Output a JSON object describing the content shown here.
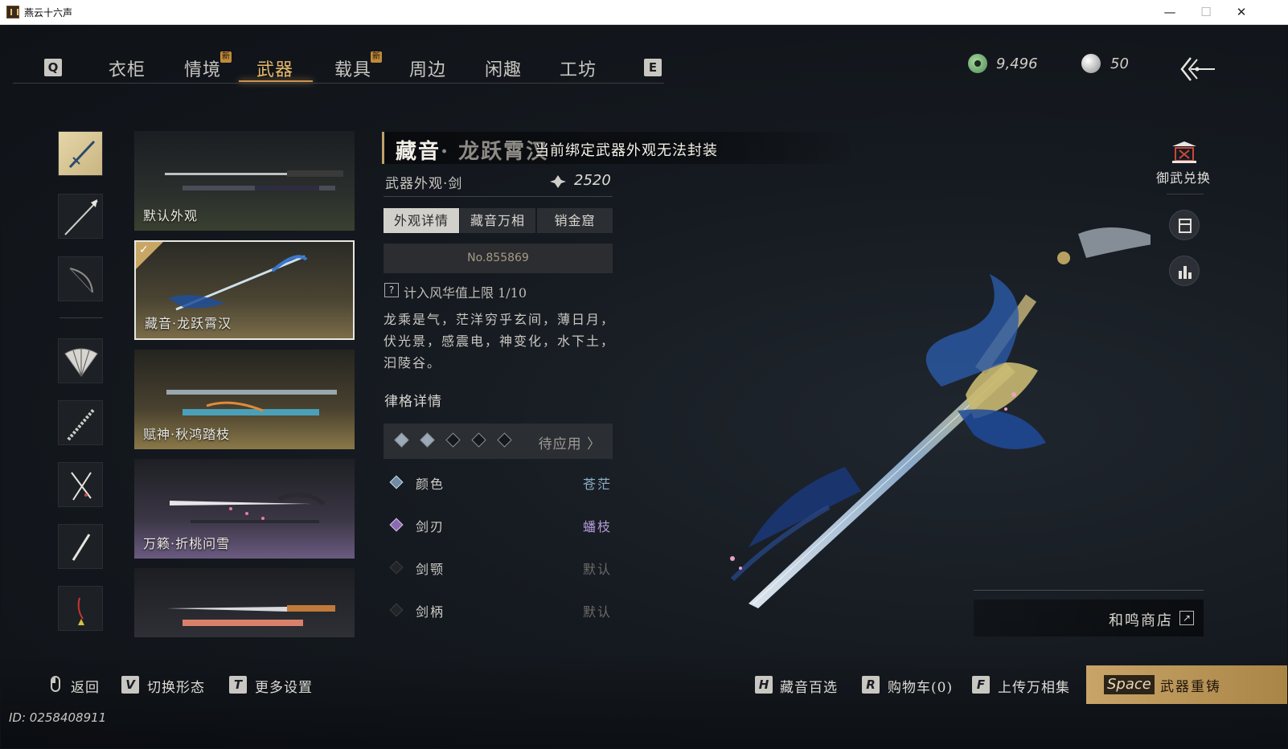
{
  "window": {
    "title": "燕云十六声",
    "min": "—",
    "max": "☐",
    "close": "✕"
  },
  "nav": {
    "left_key": "Q",
    "right_key": "E",
    "tabs": [
      {
        "label": "衣柜"
      },
      {
        "label": "情境",
        "badge": "新"
      },
      {
        "label": "武器",
        "active": true
      },
      {
        "label": "载具",
        "badge": "新"
      },
      {
        "label": "周边"
      },
      {
        "label": "闲趣"
      },
      {
        "label": "工坊"
      }
    ]
  },
  "currency": {
    "jade": "9,496",
    "pearl": "50"
  },
  "categories": [
    "sword",
    "spear",
    "bow",
    "fan",
    "umbrella",
    "dual-blades",
    "mo-dao",
    "rope-dart"
  ],
  "skins": [
    {
      "label": "默认外观"
    },
    {
      "label": "藏音·龙跃霄汉",
      "selected": true
    },
    {
      "label": "赋神·秋鸿踏枝"
    },
    {
      "label": "万籁·折桃问雪"
    },
    {
      "label": ""
    }
  ],
  "detail": {
    "name_main": "藏音",
    "name_rest": "· 龙跃霄汉",
    "toast": "当前绑定武器外观无法封装",
    "subtitle": "武器外观·剑",
    "price": "2520",
    "tabs": [
      "外观详情",
      "藏音万相",
      "销金窟"
    ],
    "serial": "No.855869",
    "fame_label": "计入风华值上限 1/10",
    "description": "龙乘是气，茫洋穷乎玄间，薄日月，伏光景，感震电，神变化，水下土，汩陵谷。",
    "section_title": "律格详情",
    "slots": [
      "filled",
      "filled",
      "empty",
      "empty",
      "empty"
    ],
    "pending": "待应用 〉",
    "attributes": [
      {
        "label": "颜色",
        "value": "苍茫",
        "active": true,
        "color": "#8fb2c9"
      },
      {
        "label": "剑刃",
        "value": "蟠枝",
        "active": true,
        "color": "#b39ad6"
      },
      {
        "label": "剑颚",
        "value": "默认",
        "active": false,
        "color": "#6d6b66"
      },
      {
        "label": "剑柄",
        "value": "默认",
        "active": false,
        "color": "#6d6b66"
      }
    ]
  },
  "side": {
    "exchange_label": "御武兑换",
    "shop_label": "和鸣商店"
  },
  "bottom": {
    "back": "返回",
    "switch_key": "V",
    "switch": "切换形态",
    "settings_key": "T",
    "settings": "更多设置",
    "pick_key": "H",
    "pick": "藏音百选",
    "cart_key": "R",
    "cart": "购物车(0)",
    "upload_key": "F",
    "upload": "上传万相集",
    "recast_key": "Space",
    "recast": "武器重铸"
  },
  "uid": "ID: 0258408911",
  "colors": {
    "accent_gold": "#e6b86a",
    "highlight_blue": "#8fb2c9"
  }
}
